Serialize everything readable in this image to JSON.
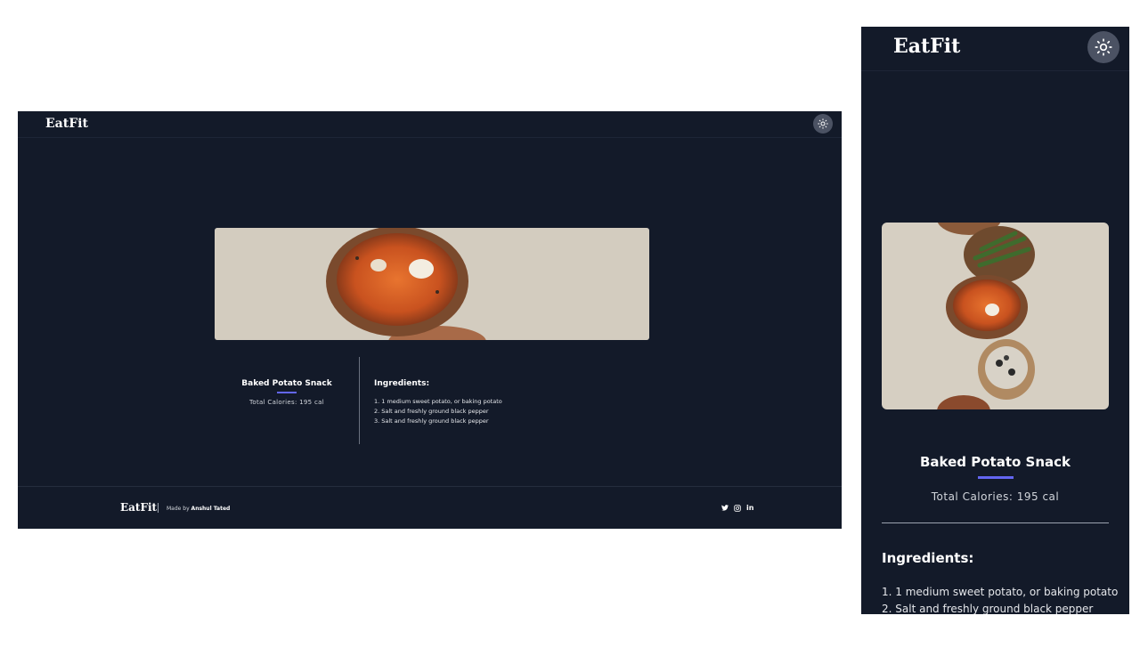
{
  "brand": {
    "logo": "EatFit"
  },
  "theme_toggle": {
    "icon": "sun-icon"
  },
  "recipe": {
    "title": "Baked Potato Snack",
    "calories": "Total Calories: 195 cal",
    "ingredients_heading": "Ingredients:",
    "ingredients": [
      "1. 1 medium sweet potato, or baking potato",
      "2. Salt and freshly ground black pepper",
      "3. Salt and freshly ground black pepper"
    ]
  },
  "footer": {
    "logo": "EatFit",
    "made_by_prefix": "Made by",
    "author": "Anshul Tated",
    "social_icons": [
      "twitter-icon",
      "instagram-icon",
      "linkedin-icon"
    ],
    "linkedin_text": "in"
  },
  "colors": {
    "background": "#131a29",
    "accent": "#6366f1",
    "toggle": "#4b5263"
  }
}
